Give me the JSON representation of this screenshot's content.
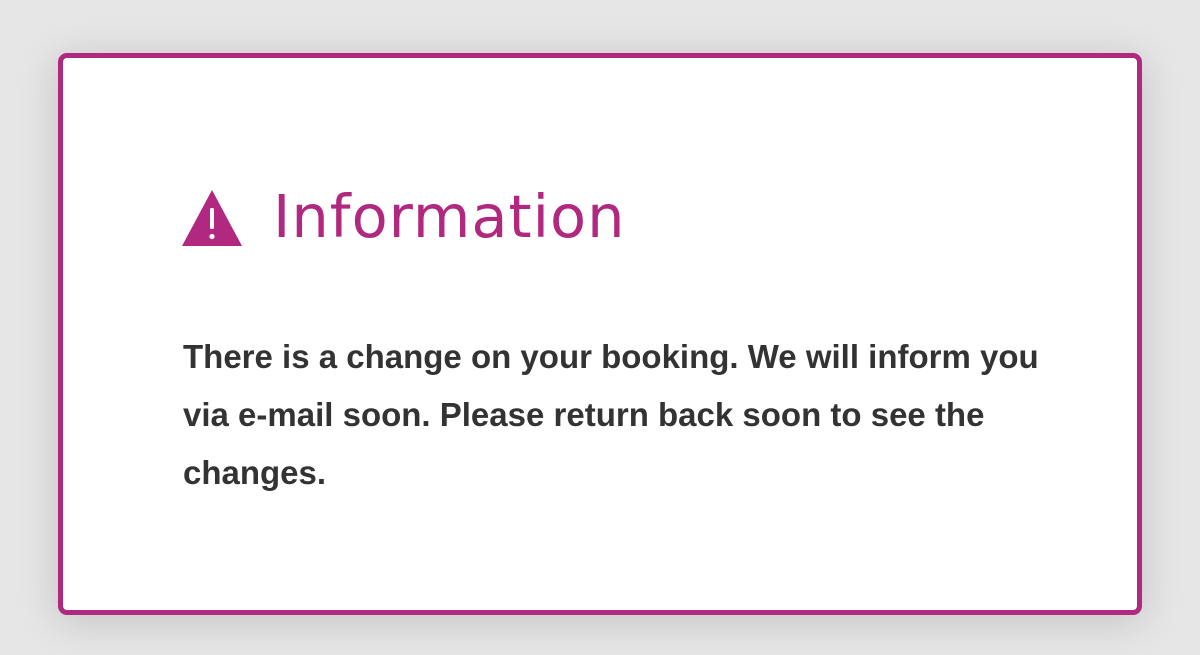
{
  "dialog": {
    "icon": "warning-triangle-icon",
    "title": "Information",
    "message": "There is a change on your booking. We will inform you via e-mail soon. Please return back soon to see the changes."
  },
  "colors": {
    "accent": "#b0287f",
    "background": "#e6e6e6",
    "text": "#333333"
  }
}
